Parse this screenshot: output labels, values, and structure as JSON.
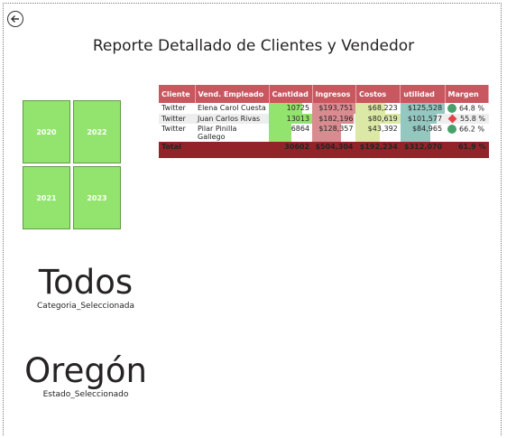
{
  "report": {
    "title": "Reporte Detallado de Clientes y Vendedor"
  },
  "year_tiles": [
    {
      "label": "2020"
    },
    {
      "label": "2022"
    },
    {
      "label": "2021"
    },
    {
      "label": "2023"
    }
  ],
  "category_card": {
    "value": "Todos",
    "label": "Categoria_Seleccionada"
  },
  "state_card": {
    "value": "Oregón",
    "label": "Estado_Seleccionado"
  },
  "table": {
    "headers": [
      "Cliente",
      "Vend. Empleado",
      "Cantidad",
      "Ingresos",
      "Costos",
      "utilidad",
      "Margen"
    ],
    "rows": [
      {
        "cliente": "Twitter",
        "vendedor": "Elena Carol Cuesta",
        "cantidad": "10725",
        "ingresos": "$193,751",
        "costos": "$68,223",
        "utilidad": "$125,528",
        "margen": "64.8 %",
        "indicator": "circle"
      },
      {
        "cliente": "Twitter",
        "vendedor": "Juan Carlos Rivas",
        "cantidad": "13013",
        "ingresos": "$182,196",
        "costos": "$80,619",
        "utilidad": "$101,577",
        "margen": "55.8 %",
        "indicator": "diamond"
      },
      {
        "cliente": "Twitter",
        "vendedor": "Pilar Pinilla Gallego",
        "cantidad": "6864",
        "ingresos": "$128,357",
        "costos": "$43,392",
        "utilidad": "$84,965",
        "margen": "66.2 %",
        "indicator": "circle"
      }
    ],
    "total": {
      "label": "Total",
      "cantidad": "30602",
      "ingresos": "$504,304",
      "costos": "$192,234",
      "utilidad": "$312,070",
      "margen": "61.9 %"
    }
  },
  "colors": {
    "tile": "#93e36f",
    "header": "#c9575f",
    "total_row": "#922329",
    "bar_cantidad": "#93e36f",
    "bar_ingresos": "#d98c90",
    "bar_costos": "#dbe8a6",
    "bar_utilidad": "#94c7c0"
  },
  "icons": {
    "back": "back-arrow-circle-icon",
    "margin_good": "green-circle-icon",
    "margin_bad": "red-diamond-icon"
  }
}
